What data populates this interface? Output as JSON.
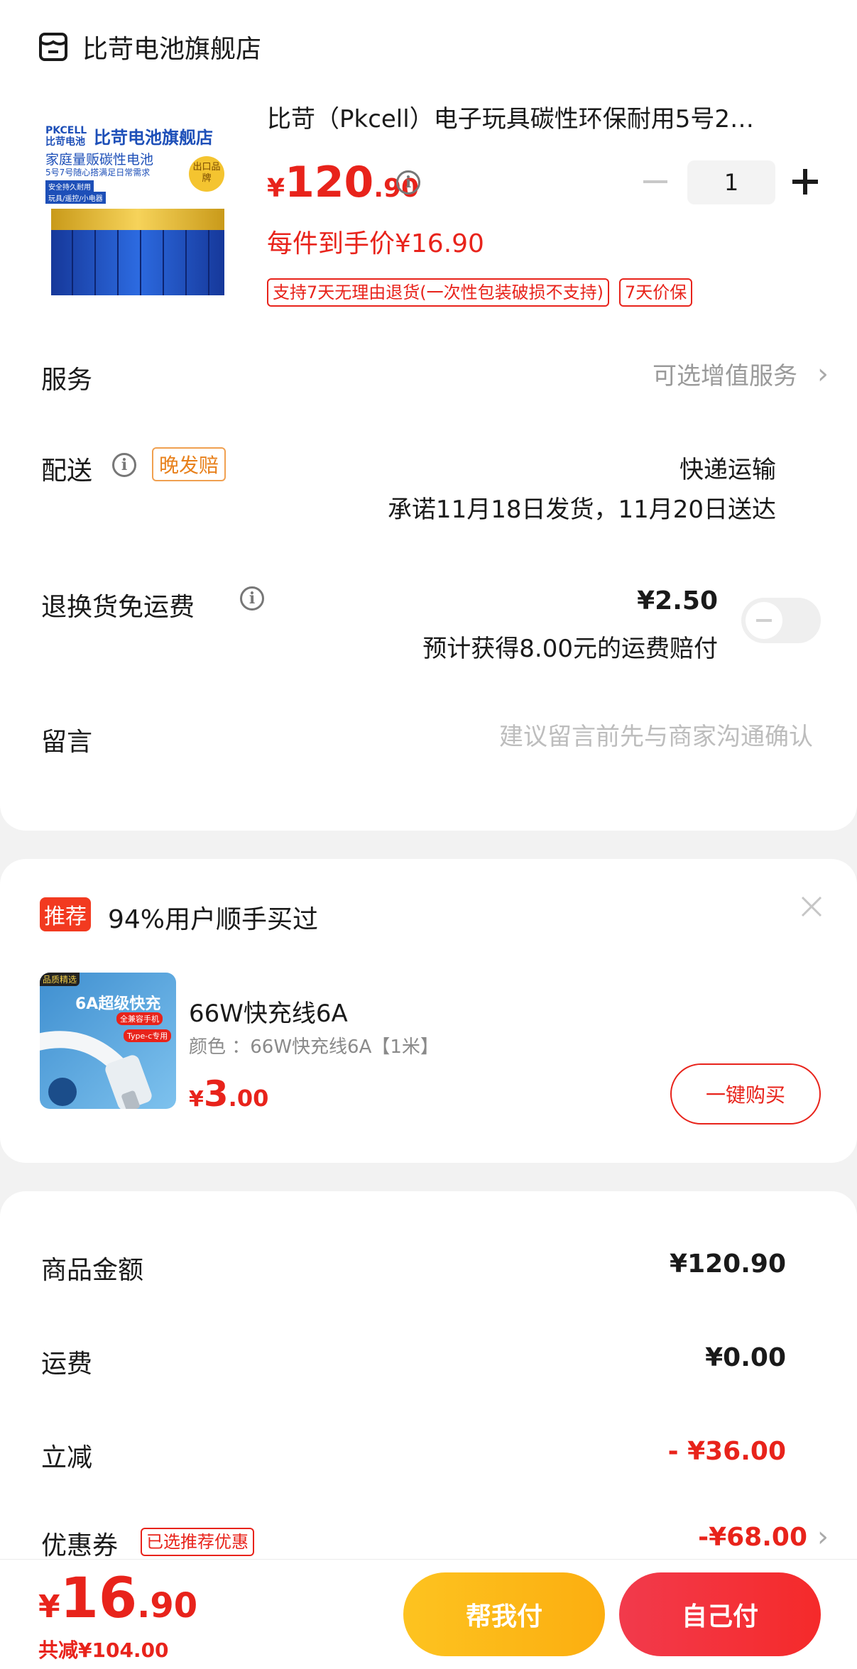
{
  "store": {
    "name": "比苛电池旗舰店",
    "icon": "store-icon"
  },
  "product": {
    "image_brand_tag": "PKCELL 比苛电池",
    "image_title": "比苛电池旗舰店",
    "image_line1": "家庭量贩碳性电池",
    "image_line2": "5号7号随心搭满足日常需求",
    "image_tag1": "安全持久耐用",
    "image_tag2": "玩具/遥控/小电器",
    "image_badge": "出口品牌",
    "title": "比苛（Pkcell）电子玩具碳性环保耐用5号2…",
    "price_symbol": "¥",
    "price_int": "120",
    "price_dec": ".90",
    "quantity": "1",
    "minus_icon": "minus-icon",
    "plus_icon": "plus-icon",
    "unit_price_text": "每件到手价¥16.90",
    "tags": [
      "支持7天无理由退货(一次性包装破损不支持)",
      "7天价保"
    ]
  },
  "service": {
    "label": "服务",
    "value": "可选增值服务"
  },
  "delivery": {
    "label": "配送",
    "badge": "晚发赔",
    "method": "快递运输",
    "promise": "承诺11月18日发货，11月20日送达"
  },
  "return_shipping": {
    "label": "退换货免运费",
    "price": "¥2.50",
    "note": "预计获得8.00元的运费赔付",
    "toggle_on": false
  },
  "message": {
    "label": "留言",
    "placeholder": "建议留言前先与商家沟通确认"
  },
  "recommend": {
    "badge": "推荐",
    "headline": "94%用户顺手买过",
    "item": {
      "image_tag": "品质精选",
      "image_title": "6A超级快充",
      "image_sub1": "全兼容手机",
      "image_sub2": "Type-c专用",
      "name": "66W快充线6A",
      "spec": "颜色 ：66W快充线6A【1米】",
      "price_symbol": "¥",
      "price_int": "3",
      "price_dec": ".00",
      "buy_label": "一键购买"
    }
  },
  "summary": {
    "rows": [
      {
        "label": "商品金额",
        "value": "¥120.90"
      },
      {
        "label": "运费",
        "value": "¥0.00"
      },
      {
        "label": "立减",
        "value": "- ¥36.00"
      },
      {
        "label": "优惠券",
        "value": "-¥68.00",
        "tag": "已选推荐优惠"
      }
    ]
  },
  "footer": {
    "price_symbol": "¥",
    "price_int": "16",
    "price_dec": ".90",
    "saved": "共减¥104.00",
    "help_pay": "帮我付",
    "self_pay": "自己付"
  },
  "colors": {
    "accent_red": "#e8231b",
    "help_yellow": "#fdb913",
    "self_red": "#f5303a"
  }
}
